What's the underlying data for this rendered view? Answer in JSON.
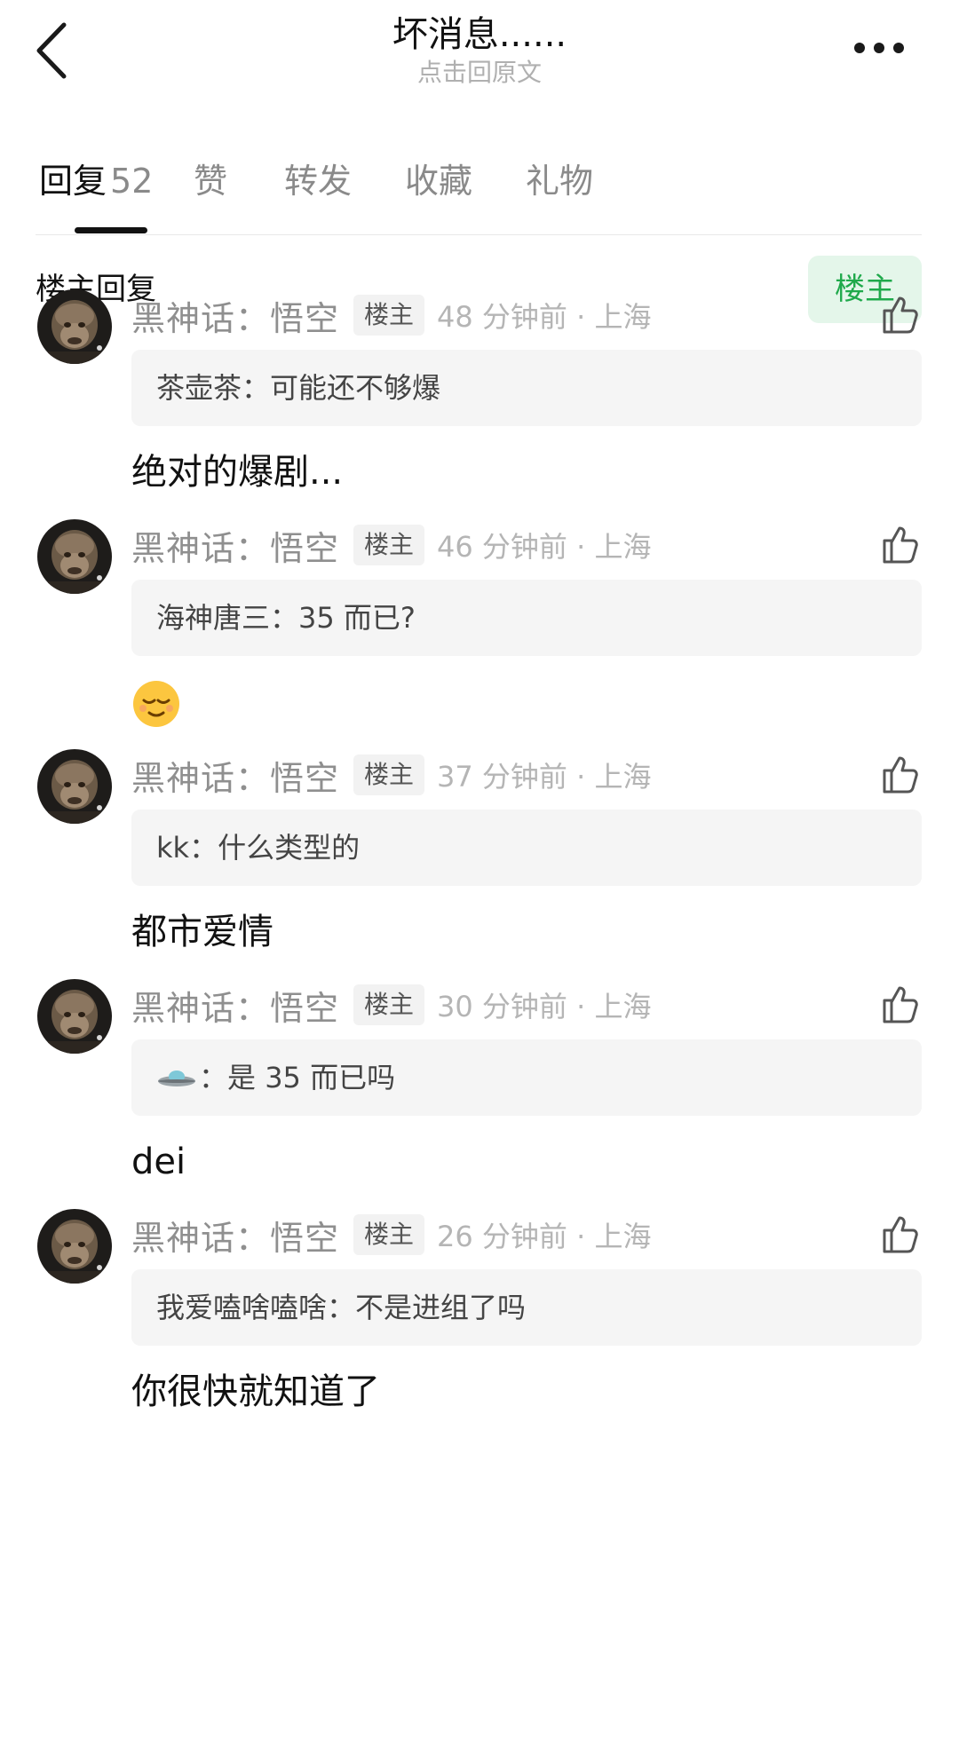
{
  "header": {
    "title": "坏消息......",
    "subtitle": "点击回原文"
  },
  "tabs": [
    {
      "label": "回复",
      "count": "52"
    },
    {
      "label": "赞"
    },
    {
      "label": "转发"
    },
    {
      "label": "收藏"
    },
    {
      "label": "礼物"
    }
  ],
  "filter": {
    "label": "楼主回复",
    "owner_button": "楼主"
  },
  "comments": [
    {
      "username": "黑神话：悟空",
      "badge": "楼主",
      "time": "48 分钟前 · 上海",
      "quote_user": "茶壶茶",
      "quote_text": "可能还不够爆",
      "reply": "绝对的爆剧..."
    },
    {
      "username": "黑神话：悟空",
      "badge": "楼主",
      "time": "46 分钟前 · 上海",
      "quote_user": "海神唐三",
      "quote_text": "35 而已?",
      "reply_emoji": "relieved-face"
    },
    {
      "username": "黑神话：悟空",
      "badge": "楼主",
      "time": "37 分钟前 · 上海",
      "quote_user": "kk",
      "quote_text": "什么类型的",
      "reply": "都市爱情"
    },
    {
      "username": "黑神话：悟空",
      "badge": "楼主",
      "time": "30 分钟前 · 上海",
      "quote_user_icon": "ufo-icon",
      "quote_text": "是 35 而已吗",
      "reply": "dei"
    },
    {
      "username": "黑神话：悟空",
      "badge": "楼主",
      "time": "26 分钟前 · 上海",
      "quote_user": "我爱嗑啥嗑啥",
      "quote_text": "不是进组了吗",
      "reply": "你很快就知道了"
    }
  ],
  "colors": {
    "accent_green": "#1fa94b",
    "owner_button_bg": "#e4f6ea",
    "quote_bg": "#f5f5f5",
    "muted_text": "#8f8f8f"
  }
}
